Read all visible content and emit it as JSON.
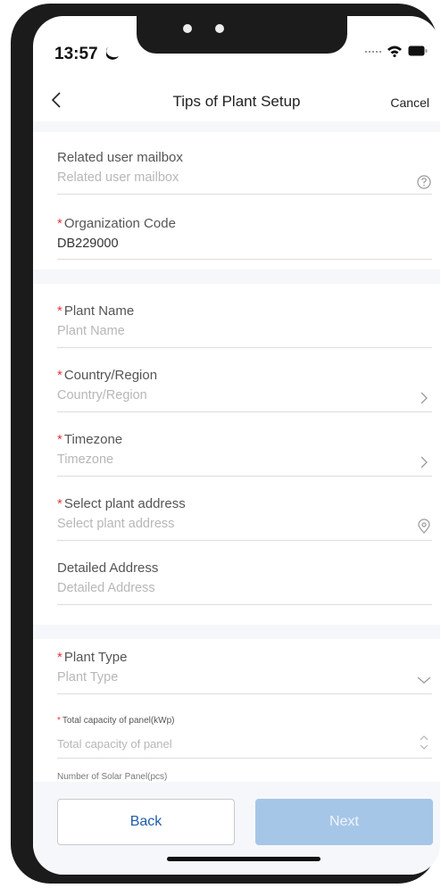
{
  "status_bar": {
    "time": "13:57"
  },
  "nav": {
    "title": "Tips of Plant Setup",
    "cancel": "Cancel"
  },
  "form": {
    "related_mailbox": {
      "label": "Related user mailbox",
      "placeholder": "Related user mailbox"
    },
    "organization_code": {
      "label": "Organization Code",
      "value": "DB229000"
    },
    "plant_name": {
      "label": "Plant Name",
      "placeholder": "Plant Name"
    },
    "country_region": {
      "label": "Country/Region",
      "placeholder": "Country/Region"
    },
    "timezone": {
      "label": "Timezone",
      "placeholder": "Timezone"
    },
    "plant_address": {
      "label": "Select plant address",
      "placeholder": "Select plant address"
    },
    "detailed_address": {
      "label": "Detailed Address",
      "placeholder": "Detailed Address"
    },
    "plant_type": {
      "label": "Plant Type",
      "placeholder": "Plant Type"
    },
    "total_capacity": {
      "label": "Total capacity of panel(kWp)",
      "placeholder": "Total capacity of panel"
    },
    "solar_panels": {
      "label": "Number of Solar Panel(pcs)"
    },
    "required_mark": "*"
  },
  "buttons": {
    "back": "Back",
    "next": "Next"
  },
  "colors": {
    "accent": "#1f5da8",
    "required": "#e6363a",
    "next_disabled": "#a6c6e7"
  }
}
